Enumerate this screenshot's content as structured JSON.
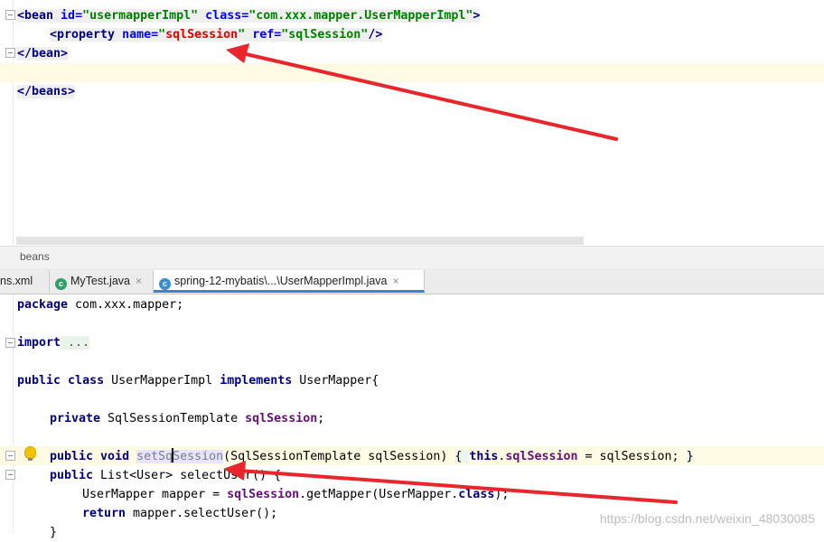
{
  "xml_editor": {
    "lines": {
      "bean_open": {
        "lt": "<",
        "tag": "bean",
        "attr1": " id=",
        "val1": "\"usermapperImpl\"",
        "attr2": " class=",
        "val2": "\"com.xxx.mapper.UserMapperImpl\"",
        "gt": ">"
      },
      "property": {
        "lt": "<",
        "tag": "property",
        "attr1": " name=",
        "q1": "\"",
        "val1": "sqlSession",
        "q2": "\"",
        "attr2": " ref=",
        "val2": "\"sqlSession\"",
        "end": "/>"
      },
      "bean_close": "</bean>",
      "beans_close": "</beans>"
    }
  },
  "breadcrumb": "beans",
  "tabs": [
    {
      "label": "ns.xml"
    },
    {
      "label": "MyTest.java",
      "icon": "java-class-test-icon"
    },
    {
      "label": "spring-12-mybatis\\...\\UserMapperImpl.java",
      "icon": "java-class-icon"
    }
  ],
  "tab_close": "×",
  "java_editor": {
    "package_kw": "package",
    "package_name": " com.xxx.mapper;",
    "import_kw": "import",
    "import_fold": " ...",
    "class_line": {
      "public": "public",
      "class": " class",
      "name": " UserMapperImpl ",
      "implements": "implements",
      "iface": " UserMapper{"
    },
    "field_line": {
      "private": "private",
      "type": " SqlSessionTemplate ",
      "name": "sqlSession",
      "semi": ";"
    },
    "setter_line": {
      "public": "public",
      "void": " void ",
      "method_a": "setSq",
      "method_b": "Session",
      "params": "(SqlSessionTemplate sqlSession) ",
      "open": "{ ",
      "this": "this",
      "dot": ".",
      "field": "sqlSession",
      "rest": " = sqlSession; ",
      "close": "}"
    },
    "select_line": {
      "public": "public",
      "rest": " List<User> selectUser() {"
    },
    "mapper_line": {
      "type": "UserMapper mapper = ",
      "field": "sqlSession",
      "rest": ".getMapper(UserMapper.",
      "class_kw": "class",
      "end": ");"
    },
    "return_line": {
      "return": "return",
      "rest": " mapper.selectUser();"
    },
    "close_line": "}"
  },
  "watermark": "https://blog.csdn.net/weixin_48030085",
  "colors": {
    "annotation_arrow": "#e8262c",
    "active_tab_underline": "#4083c9",
    "caret_row": "#fffae3"
  }
}
